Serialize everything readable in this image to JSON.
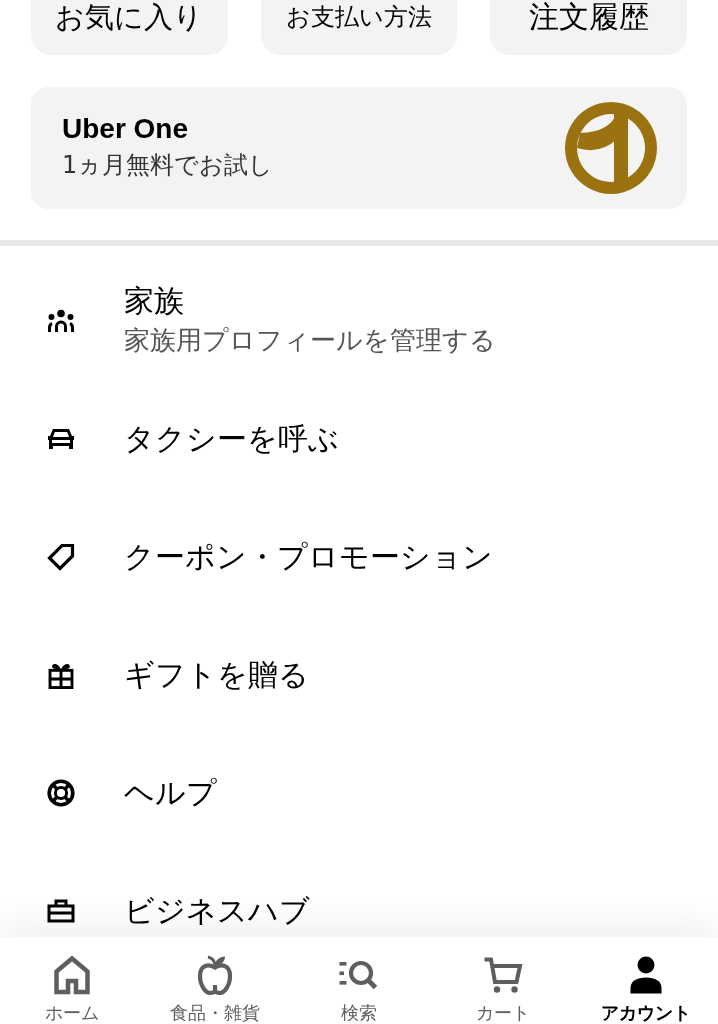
{
  "quick_actions": [
    {
      "label": "お気に入り"
    },
    {
      "label": "お支払い方法"
    },
    {
      "label": "注文履歴"
    }
  ],
  "membership": {
    "title": "Uber One",
    "subtitle": "1ヵ月無料でお試し"
  },
  "menu": [
    {
      "title": "家族",
      "subtitle": "家族用プロフィールを管理する"
    },
    {
      "title": "タクシーを呼ぶ"
    },
    {
      "title": "クーポン・プロモーション"
    },
    {
      "title": "ギフトを贈る"
    },
    {
      "title": "ヘルプ"
    },
    {
      "title": "ビジネスハブ"
    }
  ],
  "tab_bar": [
    {
      "label": "ホーム",
      "selected": false
    },
    {
      "label": "食品・雑貨",
      "selected": false
    },
    {
      "label": "検索",
      "selected": false
    },
    {
      "label": "カート",
      "selected": false
    },
    {
      "label": "アカウント",
      "selected": true
    }
  ]
}
